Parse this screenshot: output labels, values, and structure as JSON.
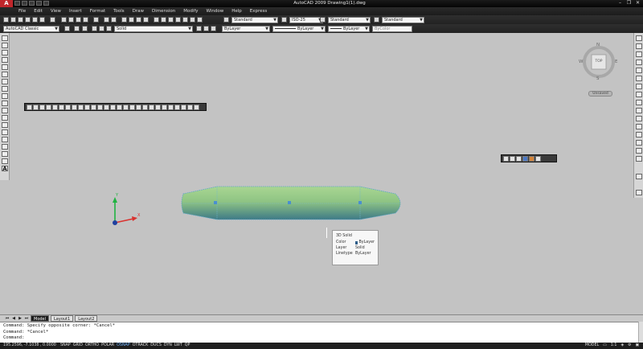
{
  "app": {
    "logo_letter": "A",
    "title": "AutoCAD 2009 Drawing1(1).dwg"
  },
  "menu": [
    "File",
    "Edit",
    "View",
    "Insert",
    "Format",
    "Tools",
    "Draw",
    "Dimension",
    "Modify",
    "Window",
    "Help",
    "Express"
  ],
  "toolbar1": {
    "text_style": "Standard",
    "dim_style": "ISO-25",
    "table_style": "Standard",
    "multileader_style": "Standard"
  },
  "toolbar2": {
    "workspace": "AutoCAD Classic",
    "visual_style": "Solid",
    "layer": "ByLayer",
    "linetype": "ByLayer",
    "lineweight": "ByLayer",
    "plot_style": "ByColor"
  },
  "viewcube": {
    "face": "TOP",
    "north": "N",
    "south": "S",
    "east": "E",
    "west": "W",
    "wcs": "Unsaved"
  },
  "tooltip": {
    "title": "3D Solid",
    "rows": [
      {
        "key": "Color",
        "value": "ByLayer",
        "swatch": "#2f5f8a"
      },
      {
        "key": "Layer",
        "value": "Solid"
      },
      {
        "key": "Linetype",
        "value": "ByLayer"
      }
    ]
  },
  "ucs": {
    "x_label": "X",
    "y_label": "Y"
  },
  "tabs": [
    "Model",
    "Layout1",
    "Layout2"
  ],
  "command_lines": [
    "Command: Specify opposite corner: *Cancel*",
    "Command: *Cancel*",
    "Command:"
  ],
  "status": {
    "coords": "195.2596, -7.1038 , 0.0000",
    "toggles": [
      "SNAP",
      "GRID",
      "ORTHO",
      "POLAR",
      "OSNAP",
      "OTRACK",
      "DUCS",
      "DYN",
      "LWT",
      "QP"
    ],
    "active_toggles": [
      "OSNAP"
    ],
    "model_label": "MODEL",
    "scale": "1:1"
  },
  "colors": {
    "solid_top": "#9bc98a",
    "solid_bottom": "#3f7f86",
    "background": "#c3c3c3"
  }
}
